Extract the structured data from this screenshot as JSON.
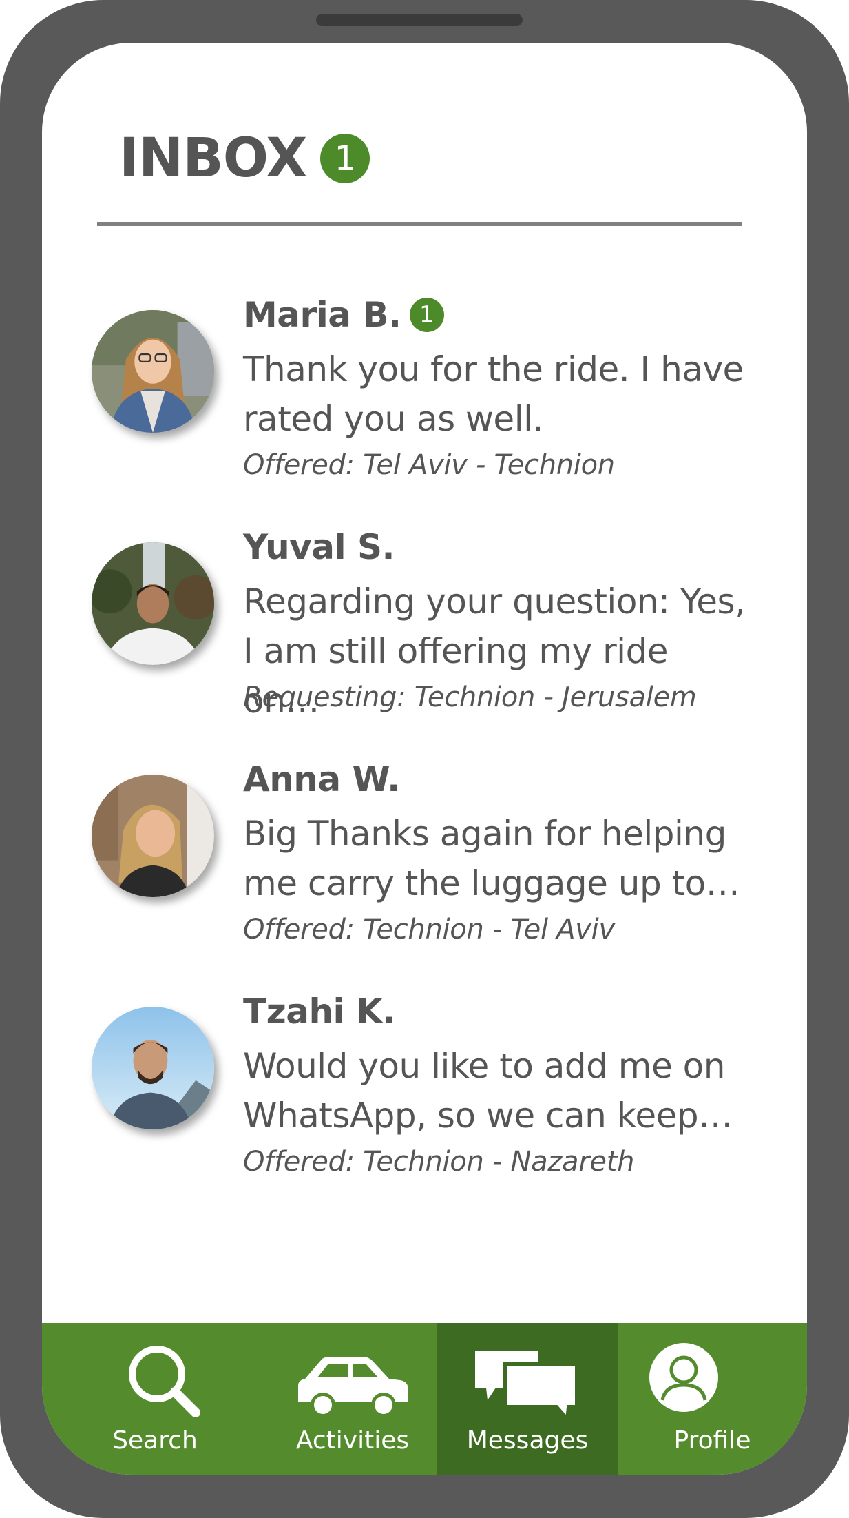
{
  "header": {
    "title": "INBOX",
    "unread_count": "1"
  },
  "messages": [
    {
      "name": "Maria B.",
      "badge": "1",
      "text": "Thank you for the ride. I have rated you as well.",
      "ride": "Offered: Tel Aviv - Technion"
    },
    {
      "name": "Yuval S.",
      "text": "Regarding your question: Yes, I am still offering my ride on…",
      "ride": "Requesting: Technion - Jerusalem"
    },
    {
      "name": "Anna W.",
      "text": "Big Thanks again for helping me carry the luggage up to…",
      "ride": "Offered: Technion - Tel Aviv"
    },
    {
      "name": "Tzahi K.",
      "text": "Would you like to add me on WhatsApp, so we can keep…",
      "ride": "Offered: Technion - Nazareth"
    }
  ],
  "nav": {
    "search": "Search",
    "activities": "Activities",
    "messages": "Messages",
    "profile": "Profile",
    "active": "messages"
  },
  "colors": {
    "frame": "#595959",
    "accent_green": "#548b2c",
    "active_tab": "#3e6b22",
    "text": "#555555"
  }
}
